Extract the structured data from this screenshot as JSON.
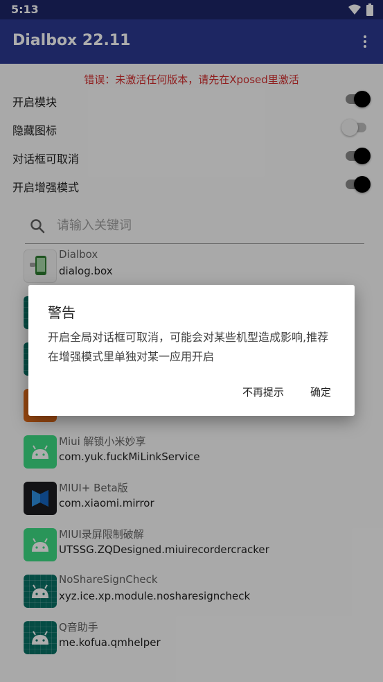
{
  "status_bar": {
    "time": "5:13"
  },
  "app_bar": {
    "title": "Dialbox 22.11"
  },
  "error": {
    "text": "错误：未激活任何版本，请先在Xposed里激活"
  },
  "switches": [
    {
      "label": "开启模块",
      "on": true
    },
    {
      "label": "隐藏图标",
      "on": false
    },
    {
      "label": "对话框可取消",
      "on": true
    },
    {
      "label": "开启增强模式",
      "on": true
    }
  ],
  "search": {
    "placeholder": "请输入关键词",
    "value": ""
  },
  "apps": [
    {
      "name": "Dialbox",
      "package": "dialog.box",
      "icon": "dialbox-icon"
    },
    {
      "name": "",
      "package": "",
      "icon": "android-dark-icon"
    },
    {
      "name": "",
      "package": "",
      "icon": "android-dark-icon"
    },
    {
      "name": "",
      "package": "",
      "icon": "orange-app-icon"
    },
    {
      "name": "Miui 解锁小米妙享",
      "package": "com.yuk.fuckMiLinkService",
      "icon": "android-icon"
    },
    {
      "name": "MIUI+ Beta版",
      "package": "com.xiaomi.mirror",
      "icon": "miui-plus-icon"
    },
    {
      "name": "MIUI录屏限制破解",
      "package": "UTSSG.ZQDesigned.miuirecordercracker",
      "icon": "android-icon"
    },
    {
      "name": "NoShareSignCheck",
      "package": "xyz.ice.xp.module.nosharesigncheck",
      "icon": "android-dark-icon"
    },
    {
      "name": "Q音助手",
      "package": "me.kofua.qmhelper",
      "icon": "android-dark-icon"
    }
  ],
  "dialog": {
    "title": "警告",
    "message": "开启全局对话框可取消，可能会对某些机型造成影响,推荐在增强模式里单独对某一应用开启",
    "dismiss_label": "不再提示",
    "ok_label": "确定"
  },
  "colors": {
    "status_bar": "#1d2668",
    "app_bar": "#2b3991",
    "error": "#d32f2f",
    "android_green": "#3ddc84"
  }
}
